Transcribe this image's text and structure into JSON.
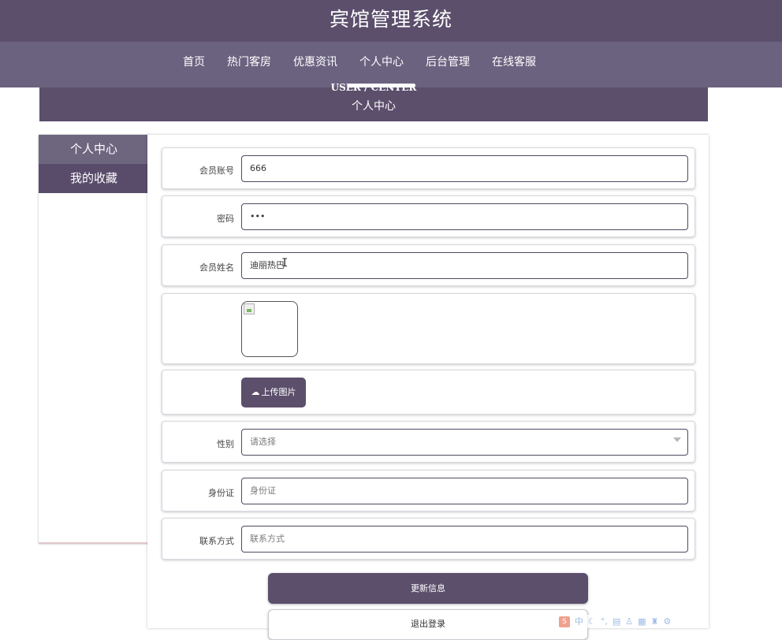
{
  "site": {
    "title": "宾馆管理系统"
  },
  "nav": {
    "items": [
      {
        "label": "首页"
      },
      {
        "label": "热门客房"
      },
      {
        "label": "优惠资讯"
      },
      {
        "label": "个人中心"
      },
      {
        "label": "后台管理"
      },
      {
        "label": "在线客服"
      }
    ],
    "active_index": 3
  },
  "banner": {
    "en": "USER / CENTER",
    "cn": "个人中心"
  },
  "sidebar": {
    "items": [
      {
        "label": "个人中心"
      },
      {
        "label": "我的收藏"
      }
    ]
  },
  "form": {
    "account": {
      "label": "会员账号",
      "value": "666"
    },
    "password": {
      "label": "密码",
      "value": "•••"
    },
    "name": {
      "label": "会员姓名",
      "value": "迪丽热巴"
    },
    "upload": {
      "label": "上传图片",
      "icon": "cloud-upload-icon"
    },
    "gender": {
      "label": "性别",
      "placeholder": "请选择"
    },
    "idcard": {
      "label": "身份证",
      "placeholder": "身份证"
    },
    "contact": {
      "label": "联系方式",
      "placeholder": "联系方式"
    }
  },
  "actions": {
    "update_label": "更新信息",
    "logout_label": "退出登录"
  },
  "ime": {
    "mode": "中"
  },
  "colors": {
    "primary": "#5b4f6c",
    "nav": "#6b6280",
    "sidebar_active": "#6e667f"
  }
}
